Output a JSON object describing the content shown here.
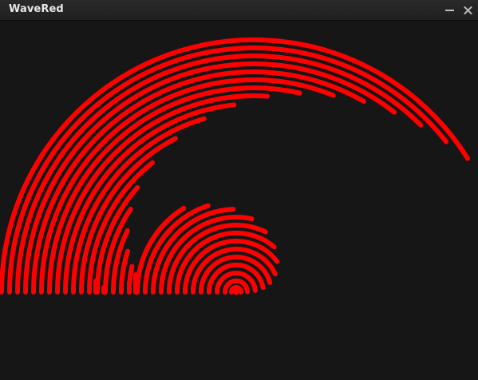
{
  "window": {
    "title": "WaveRed"
  },
  "icons": {
    "minimize": "minimize-icon",
    "close": "close-icon"
  },
  "colors": {
    "background": "#161616",
    "titlebar": "#232323",
    "wave": "#ff0000",
    "title_text": "#e8e8e8"
  }
}
